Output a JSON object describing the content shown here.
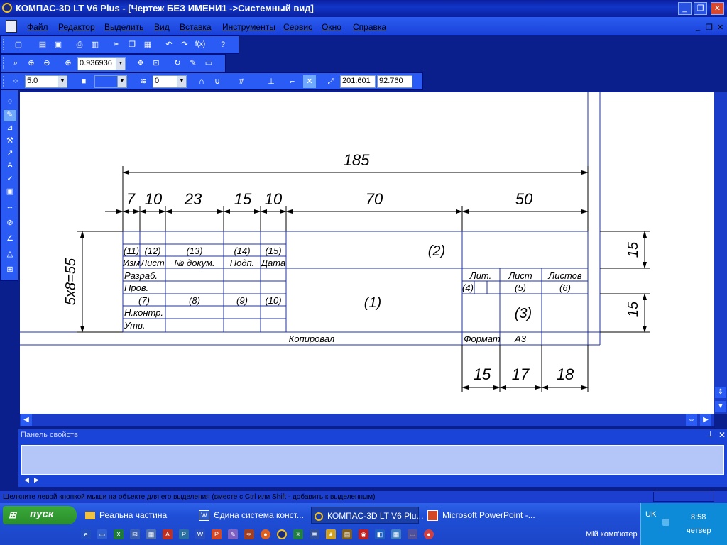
{
  "titlebar": {
    "title": "КОМПАС-3D LT V6 Plus - [Чертеж БЕЗ ИМЕНИ1 ->Системный вид]",
    "buttons": {
      "minimize": "_",
      "restore": "❐",
      "close": "✕"
    }
  },
  "menubar": {
    "items": [
      "Файл",
      "Редактор",
      "Выделить",
      "Вид",
      "Вставка",
      "Инструменты",
      "Сервис",
      "Окно",
      "Справка"
    ],
    "mdi": {
      "minimize": "_",
      "restore": "❐",
      "close": "✕"
    }
  },
  "toolbars": {
    "zoom_value": "0.936936",
    "step_value": "5.0",
    "layer_value": "0",
    "coord_x": "201.601",
    "coord_y": "92.760"
  },
  "drawing": {
    "dims": {
      "total": "185",
      "d7": "7",
      "d10a": "10",
      "d23": "23",
      "d15a": "15",
      "d10b": "10",
      "d70": "70",
      "d50": "50",
      "v15a": "15",
      "v15b": "15",
      "vleft": "5x8=55",
      "b15": "15",
      "b17": "17",
      "b18": "18"
    },
    "cells": {
      "c11": "(11)",
      "c12": "(12)",
      "c13": "(13)",
      "c14": "(14)",
      "c15": "(15)",
      "izm": "Изм",
      "list": "Лист",
      "ndoc": "№ докум.",
      "podp": "Подп.",
      "data": "Дата",
      "razrab": "Разраб.",
      "prov": "Пров.",
      "nkontr": "Н.контр.",
      "utv": "Утв.",
      "c7": "(7)",
      "c8": "(8)",
      "c9": "(9)",
      "c10": "(10)",
      "c2": "(2)",
      "c1": "(1)",
      "c3": "(3)",
      "lit": "Лит.",
      "list2": "Лист",
      "listov": "Листов",
      "c4": "(4)",
      "c5": "(5)",
      "c6": "(6)",
      "kopiroval": "Копировал",
      "format": "Формат",
      "a3": "А3"
    }
  },
  "properties_panel": {
    "title": "Панель свойств"
  },
  "status": {
    "text": "Щелкните левой кнопкой мыши на объекте для его выделения (вместе с Ctrl или Shift - добавить к выделенным)"
  },
  "taskbar": {
    "start": "пуск",
    "tasks": [
      "Реальна частина",
      "Єдина система конст...",
      "КОМПАС-3D LT V6 Plu...",
      "Microsoft PowerPoint -..."
    ],
    "lang": "UK",
    "time": "8:58",
    "day": "четвер",
    "mycomputer": "Мій комп'ютер",
    "more": "»"
  }
}
